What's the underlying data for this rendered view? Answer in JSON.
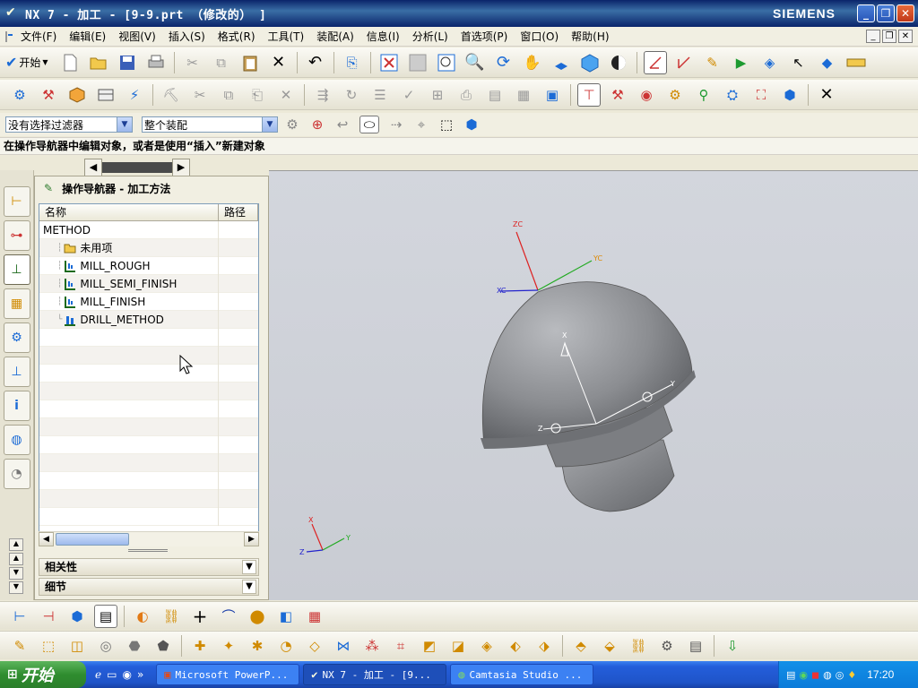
{
  "window": {
    "title": "NX 7 - 加工 - [9-9.prt （修改的） ]",
    "brand": "SIEMENS"
  },
  "menubar": {
    "items": [
      {
        "label": "文件(F)"
      },
      {
        "label": "编辑(E)"
      },
      {
        "label": "视图(V)"
      },
      {
        "label": "插入(S)"
      },
      {
        "label": "格式(R)"
      },
      {
        "label": "工具(T)"
      },
      {
        "label": "装配(A)"
      },
      {
        "label": "信息(I)"
      },
      {
        "label": "分析(L)"
      },
      {
        "label": "首选项(P)"
      },
      {
        "label": "窗口(O)"
      },
      {
        "label": "帮助(H)"
      }
    ]
  },
  "toolbar": {
    "start_label": "开始"
  },
  "filterbar": {
    "selection_filter": "没有选择过滤器",
    "scope": "整个装配"
  },
  "cue_line": "在操作导航器中编辑对象，或者是使用“插入”新建对象",
  "navigator": {
    "title": "操作导航器 - 加工方法",
    "col_name": "名称",
    "col_path": "路径",
    "root": "METHOD",
    "items": [
      {
        "label": "未用项",
        "icon": "folder-icon"
      },
      {
        "label": "MILL_ROUGH",
        "icon": "mill-method-icon"
      },
      {
        "label": "MILL_SEMI_FINISH",
        "icon": "mill-method-icon"
      },
      {
        "label": "MILL_FINISH",
        "icon": "mill-method-icon"
      },
      {
        "label": "DRILL_METHOD",
        "icon": "drill-method-icon"
      }
    ],
    "section_related": "相关性",
    "section_details": "细节"
  },
  "axes": {
    "xc": "XC",
    "yc": "YC",
    "zc": "ZC",
    "x": "X",
    "y": "Y",
    "z": "Z"
  },
  "taskbar": {
    "start": "开始",
    "tasks": [
      {
        "label": "Microsoft PowerP..."
      },
      {
        "label": "NX 7 - 加工 - [9..."
      },
      {
        "label": "Camtasia Studio ..."
      }
    ],
    "clock": "17:20"
  },
  "colors": {
    "title_bar": "#0a246a",
    "taskbar": "#245edb",
    "graphics_bg": "#d0d3da",
    "model": "#8a8c90"
  }
}
